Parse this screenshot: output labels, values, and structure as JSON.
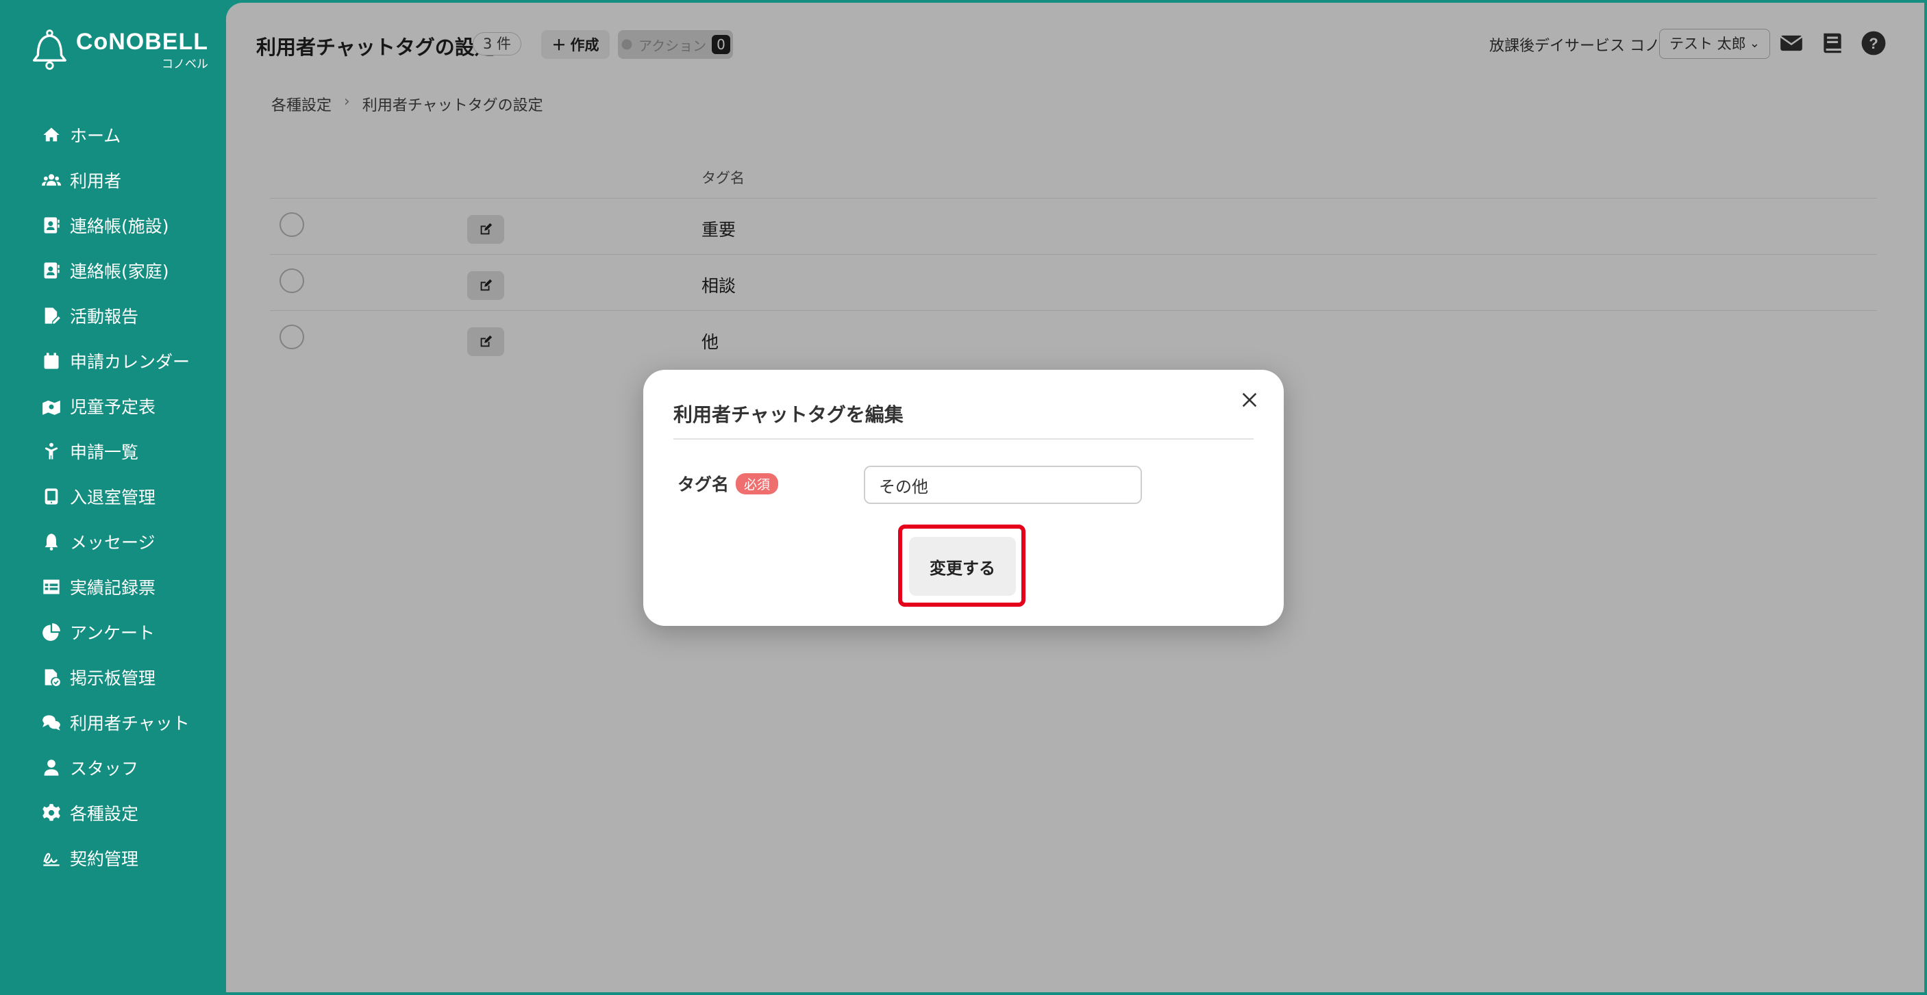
{
  "logo": {
    "main": "CoNOBELL",
    "sub": "コノベル"
  },
  "sidebar": {
    "items": [
      {
        "label": "ホーム",
        "icon": "home-icon"
      },
      {
        "label": "利用者",
        "icon": "users-icon"
      },
      {
        "label": "連絡帳(施設)",
        "icon": "contact-book-icon"
      },
      {
        "label": "連絡帳(家庭)",
        "icon": "contact-book-icon"
      },
      {
        "label": "活動報告",
        "icon": "file-edit-icon"
      },
      {
        "label": "申請カレンダー",
        "icon": "calendar-icon"
      },
      {
        "label": "児童予定表",
        "icon": "schedule-icon"
      },
      {
        "label": "申請一覧",
        "icon": "child-icon"
      },
      {
        "label": "入退室管理",
        "icon": "tablet-icon"
      },
      {
        "label": "メッセージ",
        "icon": "bell-icon"
      },
      {
        "label": "実績記録票",
        "icon": "table-icon"
      },
      {
        "label": "アンケート",
        "icon": "pie-chart-icon"
      },
      {
        "label": "掲示板管理",
        "icon": "file-check-icon"
      },
      {
        "label": "利用者チャット",
        "icon": "chat-icon"
      },
      {
        "label": "スタッフ",
        "icon": "staff-icon"
      },
      {
        "label": "各種設定",
        "icon": "gear-icon"
      },
      {
        "label": "契約管理",
        "icon": "signature-icon"
      }
    ]
  },
  "header": {
    "title": "利用者チャットタグの設定",
    "count": "3 件",
    "create_label": "作成",
    "action_label": "アクション",
    "action_count": "0",
    "facility": "放課後デイサービス コノベル",
    "user": "テスト 太郎"
  },
  "breadcrumb": {
    "parent": "各種設定",
    "current": "利用者チャットタグの設定"
  },
  "table": {
    "header_name": "タグ名",
    "rows": [
      {
        "name": "重要"
      },
      {
        "name": "相談"
      },
      {
        "name": "他"
      }
    ]
  },
  "modal": {
    "title": "利用者チャットタグを編集",
    "field_label": "タグ名",
    "required_badge": "必須",
    "field_value": "その他",
    "submit_label": "変更する"
  },
  "colors": {
    "brand": "#138e80",
    "required": "#ef6f6f",
    "highlight": "#e4001b"
  }
}
